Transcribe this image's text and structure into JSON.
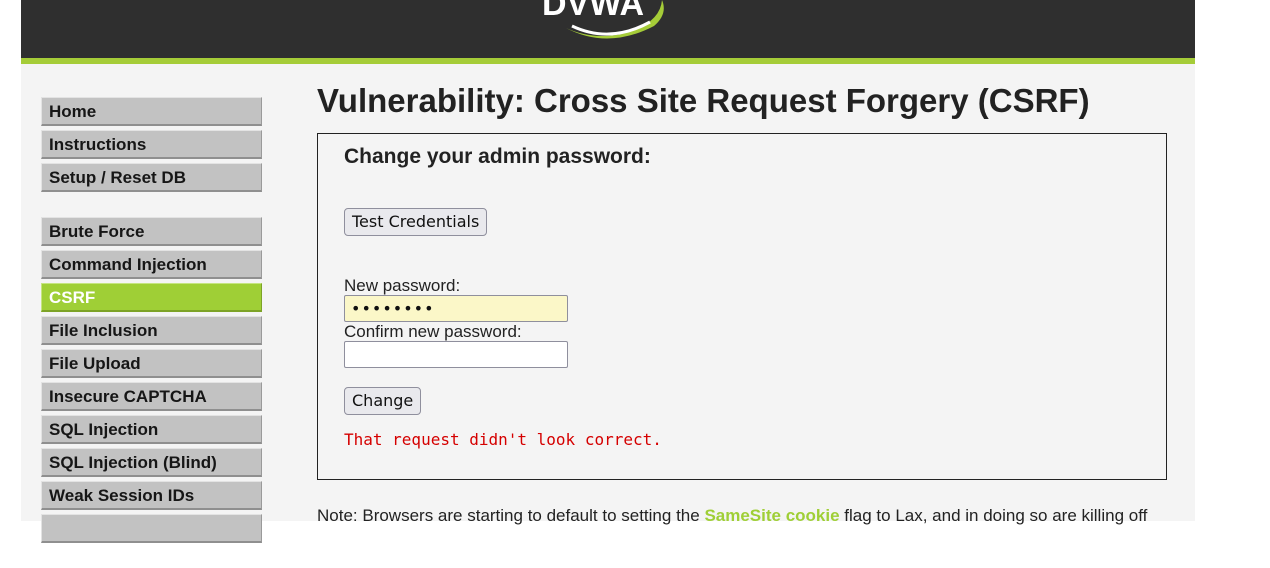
{
  "header": {
    "logo_text": "DVWA"
  },
  "sidebar": {
    "groups": [
      {
        "items": [
          {
            "label": "Home"
          },
          {
            "label": "Instructions"
          },
          {
            "label": "Setup / Reset DB"
          }
        ]
      },
      {
        "items": [
          {
            "label": "Brute Force"
          },
          {
            "label": "Command Injection"
          },
          {
            "label": "CSRF",
            "active": true
          },
          {
            "label": "File Inclusion"
          },
          {
            "label": "File Upload"
          },
          {
            "label": "Insecure CAPTCHA"
          },
          {
            "label": "SQL Injection"
          },
          {
            "label": "SQL Injection (Blind)"
          },
          {
            "label": "Weak Session IDs"
          }
        ]
      }
    ]
  },
  "main": {
    "title": "Vulnerability: Cross Site Request Forgery (CSRF)",
    "form": {
      "heading": "Change your admin password:",
      "test_button": "Test Credentials",
      "new_password_label": "New password:",
      "new_password_value": "••••••••",
      "confirm_password_label": "Confirm new password:",
      "confirm_password_value": "",
      "change_button": "Change",
      "error_message": "That request didn't look correct."
    },
    "note": {
      "prefix": "Note: Browsers are starting to default to setting the ",
      "link_text": "SameSite cookie",
      "suffix": " flag to Lax, and in doing so are killing off"
    }
  },
  "colors": {
    "accent": "#9fcf36",
    "header_bg": "#2f2f2f",
    "error": "#d50000"
  }
}
